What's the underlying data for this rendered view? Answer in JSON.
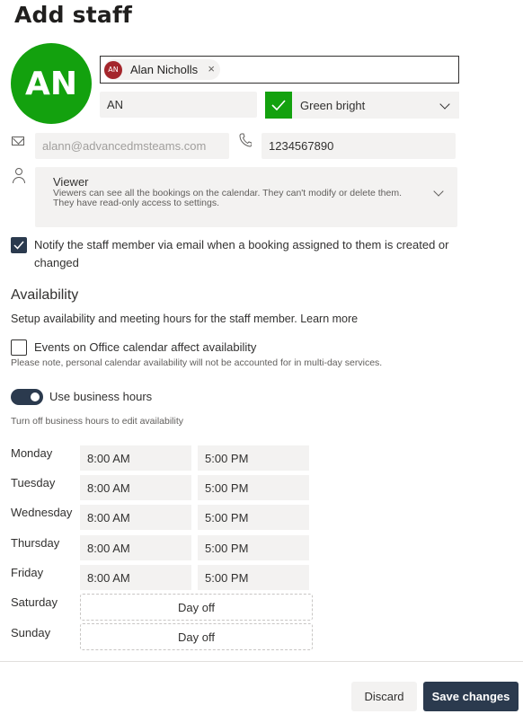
{
  "page": {
    "title": "Add staff"
  },
  "profile": {
    "avatar_initials": "AN",
    "avatar_color": "#13a10e",
    "selected_person": {
      "initials": "AN",
      "name": "Alan Nicholls",
      "remove_glyph": "×"
    },
    "initials_value": "AN",
    "color_value": "Green bright",
    "email_value": "alann@advancedmsteams.com",
    "phone_value": "1234567890"
  },
  "role": {
    "title": "Viewer",
    "description": "Viewers can see all the bookings on the calendar. They can't modify or delete them. They have read-only access to settings."
  },
  "notify": {
    "label": "Notify the staff member via email when a booking assigned to them is created or changed",
    "checked": true
  },
  "availability": {
    "title": "Availability",
    "description": "Setup availability and meeting hours for the staff member.",
    "learn_more": "Learn more",
    "events_label": "Events on Office calendar affect availability",
    "events_checked": false,
    "note": "Please note, personal calendar availability will not be accounted for in multi-day services.",
    "business_hours_label": "Use business hours",
    "business_hours_on": true,
    "business_hours_note": "Turn off business hours to edit availability",
    "days": [
      {
        "name": "Monday",
        "start": "8:00 AM",
        "end": "5:00 PM"
      },
      {
        "name": "Tuesday",
        "start": "8:00 AM",
        "end": "5:00 PM"
      },
      {
        "name": "Wednesday",
        "start": "8:00 AM",
        "end": "5:00 PM"
      },
      {
        "name": "Thursday",
        "start": "8:00 AM",
        "end": "5:00 PM"
      },
      {
        "name": "Friday",
        "start": "8:00 AM",
        "end": "5:00 PM"
      },
      {
        "name": "Saturday",
        "off_label": "Day off"
      },
      {
        "name": "Sunday",
        "off_label": "Day off"
      }
    ]
  },
  "footer": {
    "discard_label": "Discard",
    "save_label": "Save changes"
  },
  "colors": {
    "accent_dark": "#2b3a4e",
    "field_bg": "#f3f2f1",
    "chip_avatar": "#a4262c"
  },
  "icons": {
    "email": "mail-icon",
    "phone": "phone-icon",
    "role": "person-icon",
    "color_check": "checkmark-icon",
    "dropdown": "chevron-down-icon"
  }
}
